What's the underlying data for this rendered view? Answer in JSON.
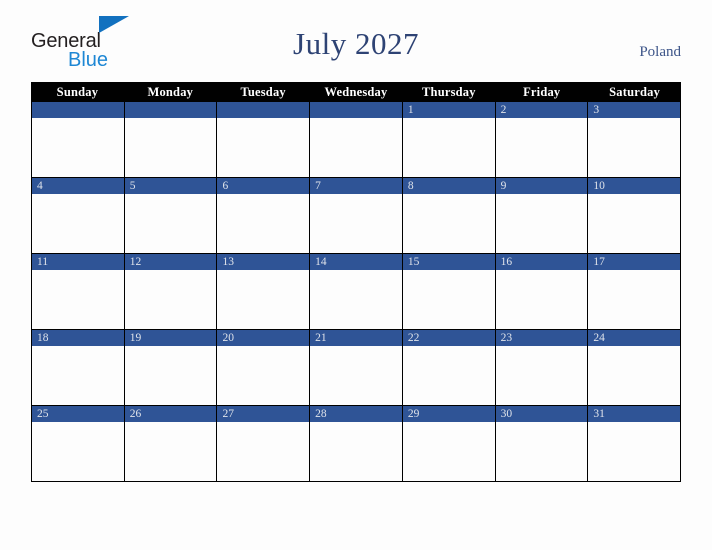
{
  "brand": {
    "name_part1": "General",
    "name_part2": "Blue",
    "triangle_color": "#1271bf",
    "part1_color": "#231f20",
    "part2_color": "#1e87d4"
  },
  "header": {
    "title": "July 2027",
    "country": "Poland",
    "title_color": "#2e4374",
    "country_color": "#3c5488"
  },
  "calendar": {
    "dow_header_bg": "#010101",
    "dow_header_color": "#ffffff",
    "day_band_bg": "#2f5496",
    "day_number_color": "#dfe3ea",
    "cell_bg": "#fdfdfd",
    "border_color": "#000000",
    "day_names": [
      "Sunday",
      "Monday",
      "Tuesday",
      "Wednesday",
      "Thursday",
      "Friday",
      "Saturday"
    ],
    "weeks": [
      [
        "",
        "",
        "",
        "",
        "1",
        "2",
        "3"
      ],
      [
        "4",
        "5",
        "6",
        "7",
        "8",
        "9",
        "10"
      ],
      [
        "11",
        "12",
        "13",
        "14",
        "15",
        "16",
        "17"
      ],
      [
        "18",
        "19",
        "20",
        "21",
        "22",
        "23",
        "24"
      ],
      [
        "25",
        "26",
        "27",
        "28",
        "29",
        "30",
        "31"
      ]
    ]
  }
}
